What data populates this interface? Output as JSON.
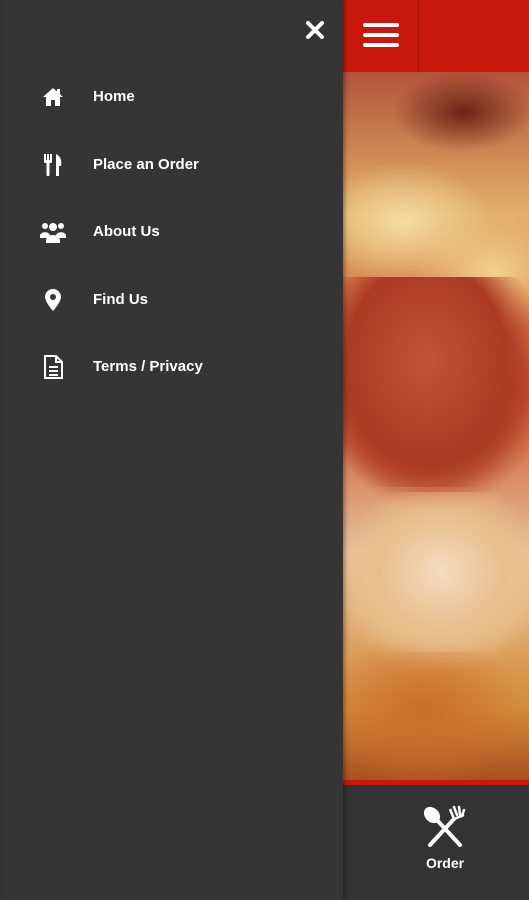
{
  "drawer": {
    "close_icon": "close-icon",
    "items": [
      {
        "label": "Home",
        "icon": "home-icon"
      },
      {
        "label": "Place an Order",
        "icon": "utensils-icon"
      },
      {
        "label": "About Us",
        "icon": "users-icon"
      },
      {
        "label": "Find Us",
        "icon": "map-marker-icon"
      },
      {
        "label": "Terms / Privacy",
        "icon": "document-icon"
      }
    ]
  },
  "app": {
    "menu_icon": "hamburger-menu-icon",
    "hero_image": "pizza-closeup",
    "bottom_nav": {
      "order_label": "Order",
      "order_icon": "fork-spoon-icon"
    }
  },
  "colors": {
    "brand_red": "#c8180b",
    "drawer_bg": "#353535",
    "text": "#ffffff"
  }
}
